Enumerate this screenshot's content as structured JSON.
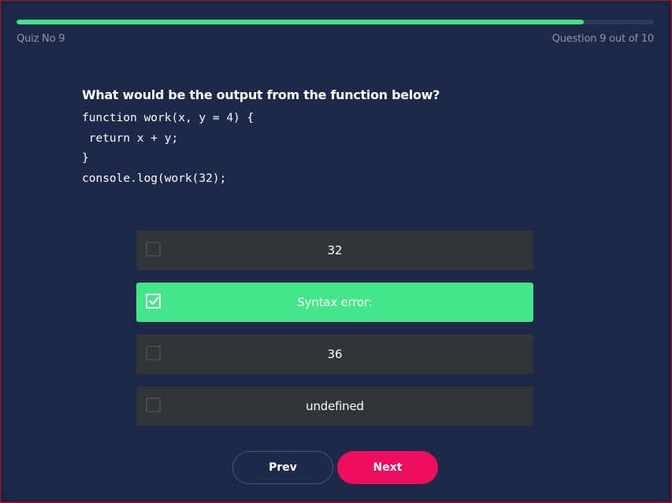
{
  "header": {
    "quiz_label": "Quiz No 9",
    "question_counter": "Question 9 out of 10",
    "progress_fraction": 0.89
  },
  "question": {
    "prompt": "What would be the output from the function below?",
    "code_lines": [
      "function work(x, y = 4) {",
      " return x + y;",
      "}",
      "console.log(work(32);"
    ]
  },
  "options": [
    {
      "label": "32",
      "selected": false
    },
    {
      "label": "Syntax error:",
      "selected": true
    },
    {
      "label": "36",
      "selected": false
    },
    {
      "label": "undefined",
      "selected": false
    }
  ],
  "nav": {
    "prev_label": "Prev",
    "next_label": "Next"
  },
  "colors": {
    "background": "#1e2849",
    "accent_green": "#43e789",
    "accent_pink": "#ef0d5f",
    "option_bg": "#323537"
  }
}
